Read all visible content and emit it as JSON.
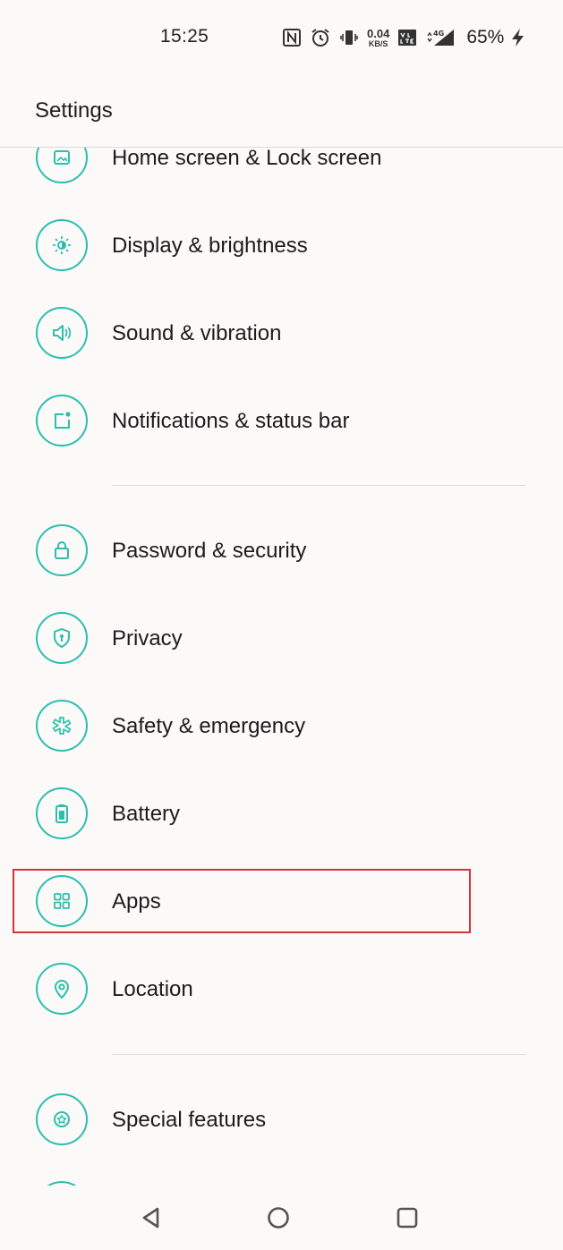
{
  "status_bar": {
    "time": "15:25",
    "net_speed": "0.04",
    "net_speed_unit": "KB/S",
    "battery_percent": "65%",
    "icons": [
      "nfc-icon",
      "alarm-icon",
      "vibrate-icon",
      "volte-icon",
      "4g-signal-icon",
      "charging-icon"
    ]
  },
  "header": {
    "title": "Settings"
  },
  "colors": {
    "accent": "#2bbfad",
    "highlight": "#d1343c",
    "background": "#fcf9f9"
  },
  "settings_items": [
    {
      "label": "Home screen & Lock screen",
      "icon": "home-screen-icon"
    },
    {
      "label": "Display & brightness",
      "icon": "brightness-icon"
    },
    {
      "label": "Sound & vibration",
      "icon": "sound-icon"
    },
    {
      "label": "Notifications & status bar",
      "icon": "notification-icon"
    },
    {
      "label": "Password & security",
      "icon": "lock-icon"
    },
    {
      "label": "Privacy",
      "icon": "privacy-shield-icon"
    },
    {
      "label": "Safety & emergency",
      "icon": "emergency-icon"
    },
    {
      "label": "Battery",
      "icon": "battery-icon"
    },
    {
      "label": "Apps",
      "icon": "apps-grid-icon"
    },
    {
      "label": "Location",
      "icon": "location-pin-icon"
    },
    {
      "label": "Special features",
      "icon": "special-features-icon"
    },
    {
      "label": "",
      "icon": "partial-item-icon"
    }
  ],
  "nav_bar": {
    "buttons": [
      "back-icon",
      "home-icon",
      "recents-icon"
    ]
  }
}
